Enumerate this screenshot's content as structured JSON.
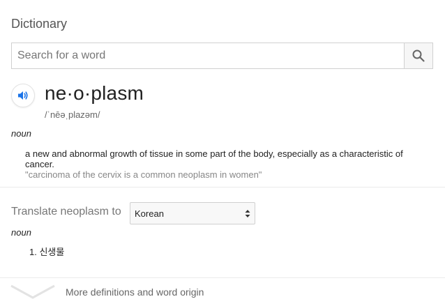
{
  "header": {
    "title": "Dictionary"
  },
  "search": {
    "placeholder": "Search for a word",
    "value": "",
    "button_icon": "search-icon"
  },
  "entry": {
    "speaker_icon": "speaker-icon",
    "headword": "ne·o·plasm",
    "phonetic": "/ˈnēəˌplazəm/",
    "part_of_speech": "noun",
    "definition": "a new and abnormal growth of tissue in some part of the body, especially as a characteristic of cancer.",
    "example": "\"carcinoma of the cervix is a common neoplasm in women\""
  },
  "translate": {
    "label": "Translate neoplasm to",
    "selected_language": "Korean",
    "part_of_speech": "noun",
    "items": [
      {
        "number": "1.",
        "text": "신생물"
      }
    ]
  },
  "footer": {
    "chevron_icon": "chevron-down-icon",
    "more_label": "More definitions and word origin"
  },
  "colors": {
    "accent": "#1a73e8",
    "text": "#222222",
    "muted": "#777777",
    "example": "#878787"
  }
}
